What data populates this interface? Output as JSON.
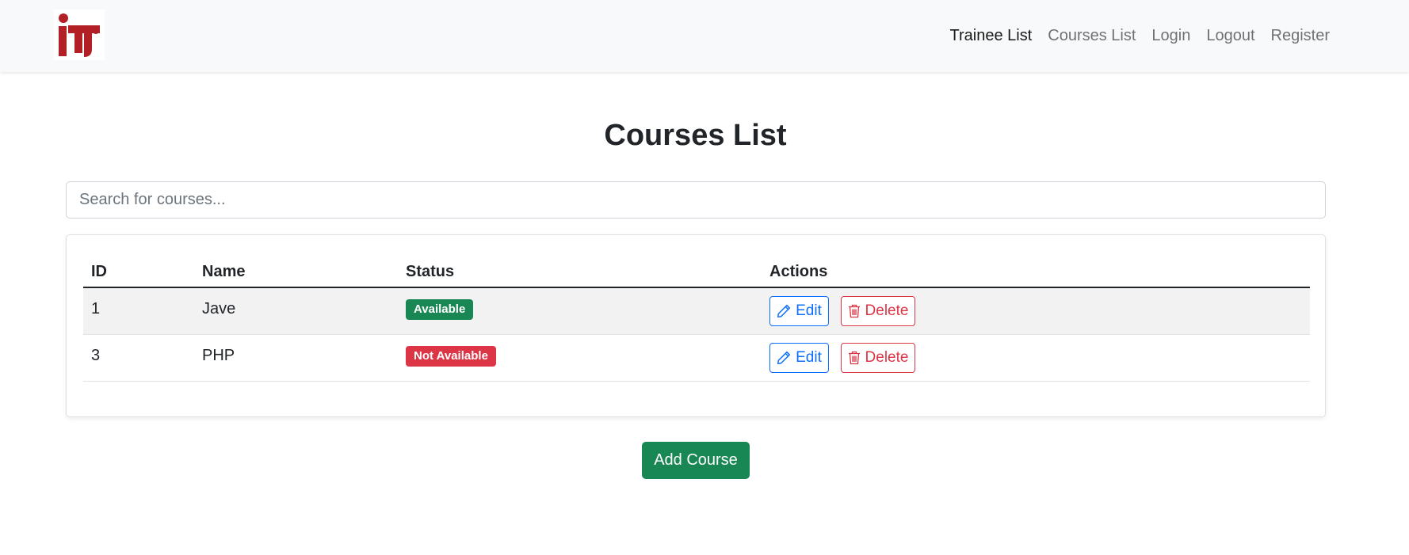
{
  "nav": {
    "logo_alt": "iti",
    "links": [
      {
        "label": "Trainee List",
        "active": true
      },
      {
        "label": "Courses List",
        "active": false
      },
      {
        "label": "Login",
        "active": false
      },
      {
        "label": "Logout",
        "active": false
      },
      {
        "label": "Register",
        "active": false
      }
    ]
  },
  "main": {
    "title": "Courses List",
    "search": {
      "placeholder": "Search for courses...",
      "value": ""
    },
    "table": {
      "headers": [
        "ID",
        "Name",
        "Status",
        "Actions"
      ],
      "rows": [
        {
          "id": "1",
          "name": "Jave",
          "status": "Available",
          "status_color": "#198754",
          "edit": "Edit",
          "delete": "Delete"
        },
        {
          "id": "3",
          "name": "PHP",
          "status": "Not Available",
          "status_color": "#dc3545",
          "edit": "Edit",
          "delete": "Delete"
        }
      ]
    },
    "add_button": "Add Course"
  },
  "colors": {
    "primary": "#0d6efd",
    "success": "#198754",
    "danger": "#dc3545",
    "logo": "#b22025"
  },
  "icons": {
    "edit": "pencil-icon",
    "delete": "trash-icon"
  }
}
